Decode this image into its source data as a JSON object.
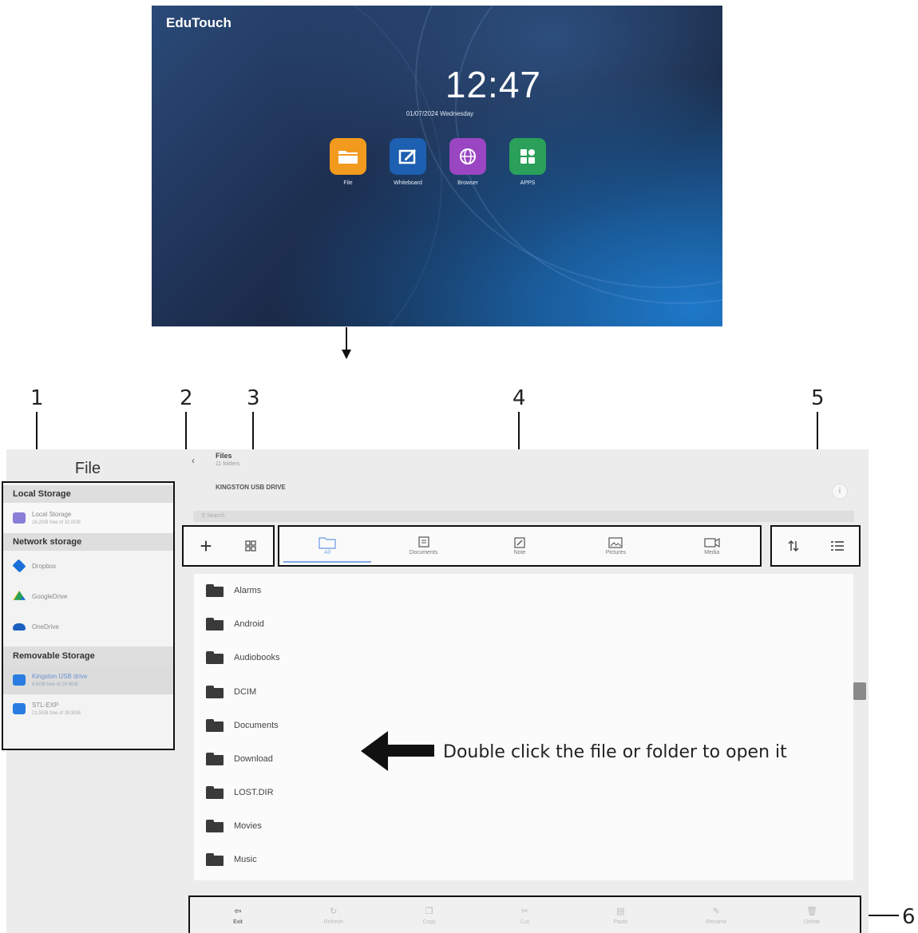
{
  "launcher": {
    "brand": "EduTouch",
    "time": "12:47",
    "date": "01/07/2024 Wednesday",
    "apps": [
      {
        "label": "File",
        "icon": "folder-icon",
        "color": "#f29a1d"
      },
      {
        "label": "Whiteboard",
        "icon": "whiteboard-icon",
        "color": "#1d5fb0"
      },
      {
        "label": "Browser",
        "icon": "globe-icon",
        "color": "#9a46c2"
      },
      {
        "label": "APPS",
        "icon": "apps-icon",
        "color": "#2aa05a"
      }
    ]
  },
  "callouts": [
    "1",
    "2",
    "3",
    "4",
    "5",
    "6"
  ],
  "file_manager": {
    "sidebar": {
      "title": "File",
      "sections": [
        {
          "heading": "Local Storage",
          "items": [
            {
              "label": "Local Storage",
              "sub": "16.2GB free of 32.0GB",
              "icon": "local-storage-icon",
              "color": "#8a7fd8"
            }
          ]
        },
        {
          "heading": "Network storage",
          "items": [
            {
              "label": "Dropbox",
              "sub": "",
              "icon": "dropbox-icon",
              "color": "#1b6fd8"
            },
            {
              "label": "GoogleDrive",
              "sub": "",
              "icon": "google-drive-icon",
              "color": "#2aa05a"
            },
            {
              "label": "OneDrive",
              "sub": "",
              "icon": "onedrive-icon",
              "color": "#1b5fc0"
            }
          ]
        },
        {
          "heading": "Removable Storage",
          "items": [
            {
              "label": "Kingston USB drive",
              "sub": "9.8GB free of 28.9GB",
              "icon": "usb-drive-icon",
              "color": "#2a7de0"
            },
            {
              "label": "STL-EXP",
              "sub": "21.5GB free of 28.9GB",
              "icon": "usb-drive-icon",
              "color": "#2a7de0"
            }
          ]
        }
      ]
    },
    "header": {
      "back": "‹",
      "title": "Files",
      "subtitle": "11 folders",
      "drive": "KINGSTON USB DRIVE",
      "info": "i",
      "search_placeholder": "Search"
    },
    "toolbar_left": {
      "add": "+",
      "select": "Select"
    },
    "categories": [
      {
        "label": "All",
        "icon": "all-files-icon"
      },
      {
        "label": "Documents",
        "icon": "documents-icon"
      },
      {
        "label": "Note",
        "icon": "note-icon"
      },
      {
        "label": "Pictures",
        "icon": "pictures-icon"
      },
      {
        "label": "Media",
        "icon": "media-icon"
      }
    ],
    "toolbar_right": {
      "sort": "Sort",
      "view": "View"
    },
    "folders": [
      "Alarms",
      "Android",
      "Audiobooks",
      "DCIM",
      "Documents",
      "Download",
      "LOST.DIR",
      "Movies",
      "Music"
    ],
    "hint": "Double click the file or folder to open it",
    "bottom_actions": [
      {
        "label": "Exit",
        "icon": "exit-icon",
        "active": true
      },
      {
        "label": "Refresh",
        "icon": "refresh-icon",
        "active": false
      },
      {
        "label": "Copy",
        "icon": "copy-icon",
        "active": false
      },
      {
        "label": "Cut",
        "icon": "cut-icon",
        "active": false
      },
      {
        "label": "Paste",
        "icon": "paste-icon",
        "active": false
      },
      {
        "label": "Rename",
        "icon": "rename-icon",
        "active": false
      },
      {
        "label": "Delete",
        "icon": "delete-icon",
        "active": false
      }
    ]
  }
}
